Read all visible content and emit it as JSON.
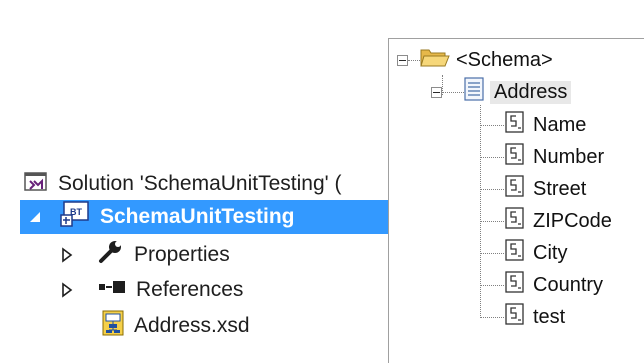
{
  "solution_explorer": {
    "solution_label": "Solution 'SchemaUnitTesting' (",
    "project_label": "SchemaUnitTesting",
    "items": [
      {
        "label": "Properties",
        "icon": "wrench-icon"
      },
      {
        "label": "References",
        "icon": "references-icon"
      },
      {
        "label": "Address.xsd",
        "icon": "xsd-file-icon"
      }
    ],
    "selection_color": "#3399ff"
  },
  "schema_tree": {
    "root": "<Schema>",
    "record": "Address",
    "fields": [
      "Name",
      "Number",
      "Street",
      "ZIPCode",
      "City",
      "Country",
      "test"
    ]
  }
}
